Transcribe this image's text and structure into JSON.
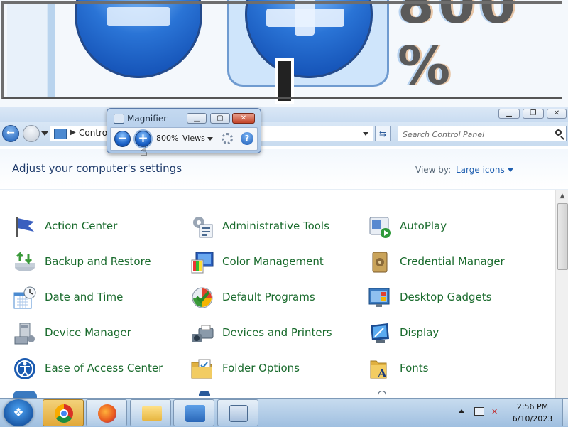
{
  "lens": {
    "zoom_text": "800 %"
  },
  "window": {
    "breadcrumb": "Control Panel",
    "search_placeholder": "Search Control Panel"
  },
  "header": {
    "title": "Adjust your computer's settings",
    "view_by_label": "View by:",
    "view_by_value": "Large icons"
  },
  "items": [
    {
      "label": "Action Center",
      "icon": "action-center-flag-icon",
      "color": "#3a5fbf"
    },
    {
      "label": "Administrative Tools",
      "icon": "administrative-tools-icon",
      "color": "#7a8aa0"
    },
    {
      "label": "AutoPlay",
      "icon": "autoplay-icon",
      "color": "#2f9a3b"
    },
    {
      "label": "Backup and Restore",
      "icon": "backup-restore-icon",
      "color": "#3a9a3a"
    },
    {
      "label": "Color Management",
      "icon": "color-management-icon",
      "color": "#2a5fbf"
    },
    {
      "label": "Credential Manager",
      "icon": "credential-manager-icon",
      "color": "#b08a3a"
    },
    {
      "label": "Date and Time",
      "icon": "date-time-icon",
      "color": "#4a8ad0"
    },
    {
      "label": "Default Programs",
      "icon": "default-programs-icon",
      "color": "#3a9a3a"
    },
    {
      "label": "Desktop Gadgets",
      "icon": "desktop-gadgets-icon",
      "color": "#3a7ac0"
    },
    {
      "label": "Device Manager",
      "icon": "device-manager-icon",
      "color": "#8a9aaa"
    },
    {
      "label": "Devices and Printers",
      "icon": "devices-printers-icon",
      "color": "#7a8a9a"
    },
    {
      "label": "Display",
      "icon": "display-icon",
      "color": "#2a7ad0"
    },
    {
      "label": "Ease of Access Center",
      "icon": "ease-of-access-icon",
      "color": "#1a5ab0"
    },
    {
      "label": "Folder Options",
      "icon": "folder-options-icon",
      "color": "#e0b040"
    },
    {
      "label": "Fonts",
      "icon": "fonts-icon",
      "color": "#e0b040"
    }
  ],
  "magnifier": {
    "title": "Magnifier",
    "zoom_out": "−",
    "zoom_in": "+",
    "zoom_level": "800%",
    "views_label": "Views",
    "help": "?"
  },
  "taskbar": {
    "apps": [
      "chrome",
      "firefox",
      "windows-explorer",
      "control-panel",
      "magnifier"
    ],
    "time": "2:56 PM",
    "date": "6/10/2023"
  }
}
